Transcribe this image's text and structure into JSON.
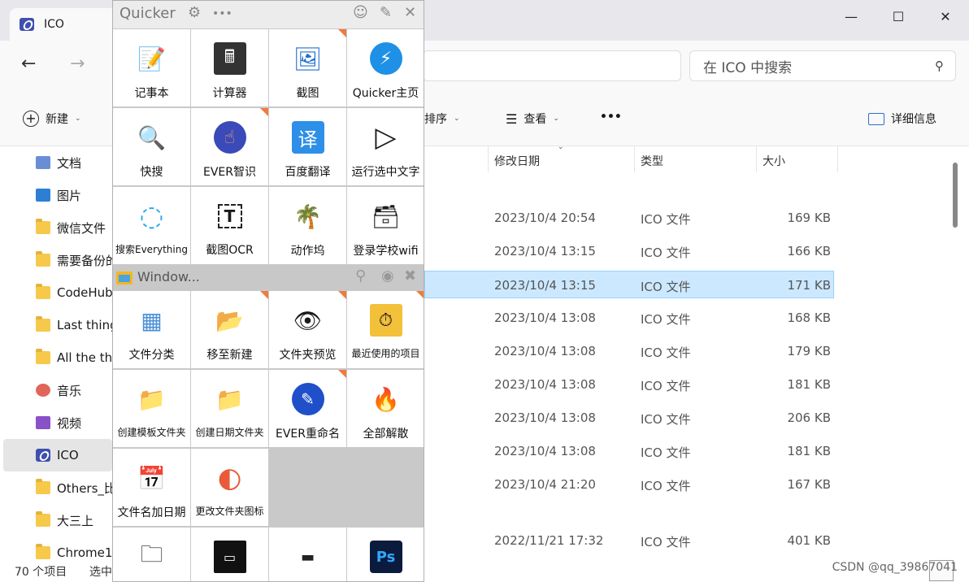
{
  "explorer": {
    "tab_title": "ICO",
    "window_buttons": [
      "—",
      "☐",
      "✕"
    ],
    "nav": {
      "back": "←",
      "forward": "→"
    },
    "search_placeholder": "在 ICO 中搜索",
    "toolbar": {
      "new": "新建",
      "sort": "排序",
      "view": "查看",
      "more": "•••",
      "details": "详细信息"
    },
    "sidebar": [
      {
        "label": "文档",
        "icon": "document-icon"
      },
      {
        "label": "图片",
        "icon": "pictures-icon"
      },
      {
        "label": "微信文件",
        "icon": "folder-icon"
      },
      {
        "label": "需要备份的",
        "icon": "folder-icon"
      },
      {
        "label": "CodeHub",
        "icon": "folder-icon"
      },
      {
        "label": "Last thing",
        "icon": "folder-icon"
      },
      {
        "label": "All the thi",
        "icon": "folder-icon"
      },
      {
        "label": "音乐",
        "icon": "music-icon"
      },
      {
        "label": "视频",
        "icon": "video-icon"
      },
      {
        "label": "ICO",
        "icon": "ico-icon"
      },
      {
        "label": "Others_比",
        "icon": "folder-icon"
      },
      {
        "label": "大三上",
        "icon": "folder-icon"
      },
      {
        "label": "Chrome1",
        "icon": "folder-icon"
      }
    ],
    "columns": {
      "date": "修改日期",
      "type": "类型",
      "size": "大小"
    },
    "rows": [
      {
        "date": "2023/10/4 20:54",
        "type": "ICO 文件",
        "size": "169 KB"
      },
      {
        "date": "2023/10/4 13:15",
        "type": "ICO 文件",
        "size": "166 KB"
      },
      {
        "date": "2023/10/4 13:15",
        "type": "ICO 文件",
        "size": "171 KB"
      },
      {
        "date": "2023/10/4 13:08",
        "type": "ICO 文件",
        "size": "168 KB"
      },
      {
        "date": "2023/10/4 13:08",
        "type": "ICO 文件",
        "size": "179 KB"
      },
      {
        "date": "2023/10/4 13:08",
        "type": "ICO 文件",
        "size": "181 KB"
      },
      {
        "date": "2023/10/4 13:08",
        "type": "ICO 文件",
        "size": "206 KB"
      },
      {
        "date": "2023/10/4 13:08",
        "type": "ICO 文件",
        "size": "181 KB"
      },
      {
        "date": "2023/10/4 21:20",
        "type": "ICO 文件",
        "size": "167 KB"
      },
      {
        "date": "2022/11/21 17:32",
        "type": "ICO 文件",
        "size": "401 KB"
      }
    ],
    "status": {
      "count": "70 个项目",
      "selected": "选中"
    },
    "watermark": "CSDN @qq_39867041"
  },
  "quicker": {
    "title": "Quicker",
    "header_icons": [
      "⚙",
      "•••",
      "☺",
      "✎",
      "✕"
    ],
    "section_title": "Window...",
    "top_actions": [
      {
        "label": "记事本",
        "glyph": "📝"
      },
      {
        "label": "计算器",
        "glyph": "🖩"
      },
      {
        "label": "截图",
        "glyph": "🖼"
      },
      {
        "label": "Quicker主页",
        "glyph": "⚡"
      },
      {
        "label": "快搜",
        "glyph": "🔍"
      },
      {
        "label": "EVER智识",
        "glyph": "☝"
      },
      {
        "label": "百度翻译",
        "glyph": "译"
      },
      {
        "label": "运行选中文字",
        "glyph": "▷"
      },
      {
        "label": "搜索Everything",
        "glyph": "◌"
      },
      {
        "label": "截图OCR",
        "glyph": "T"
      },
      {
        "label": "动作坞",
        "glyph": "🌴"
      },
      {
        "label": "登录学校wifi",
        "glyph": "🗃"
      }
    ],
    "window_actions": [
      {
        "label": "文件分类",
        "glyph": "▦"
      },
      {
        "label": "移至新建",
        "glyph": "📂"
      },
      {
        "label": "文件夹预览",
        "glyph": "👁"
      },
      {
        "label": "最近使用的项目",
        "glyph": "⏱"
      },
      {
        "label": "创建模板文件夹",
        "glyph": "📁"
      },
      {
        "label": "创建日期文件夹",
        "glyph": "📁"
      },
      {
        "label": "EVER重命名",
        "glyph": "✎"
      },
      {
        "label": "全部解散",
        "glyph": "🔥"
      },
      {
        "label": "文件名加日期",
        "glyph": "📅"
      },
      {
        "label": "更改文件夹图标",
        "glyph": "◐"
      }
    ],
    "bottom_icons": [
      "🗀",
      "▭",
      "▬",
      "Ps"
    ]
  }
}
